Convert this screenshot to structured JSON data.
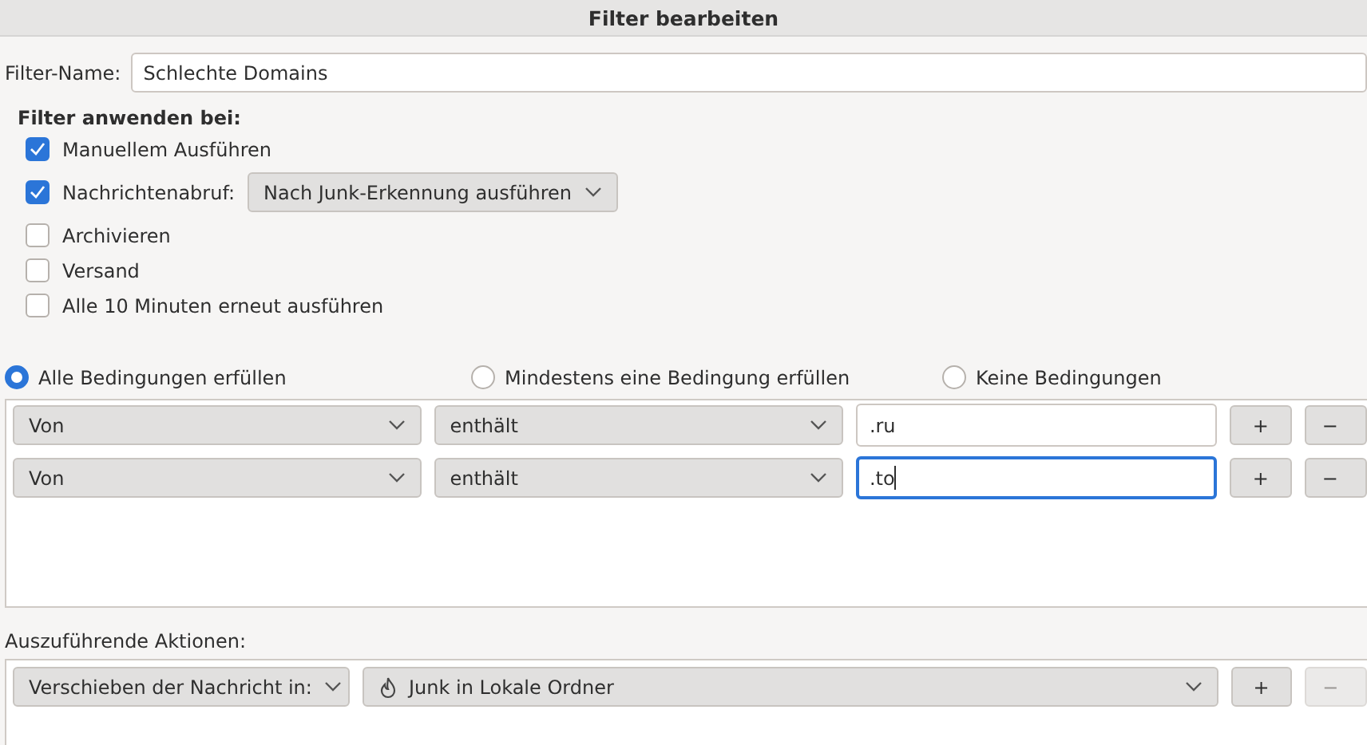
{
  "window": {
    "title": "Filter bearbeiten"
  },
  "filter_name": {
    "label": "Filter-Name:",
    "value": "Schlechte Domains"
  },
  "apply_section": {
    "heading": "Filter anwenden bei:",
    "options": [
      {
        "label": "Manuellem Ausführen",
        "checked": true
      },
      {
        "label": "Nachrichtenabruf:",
        "checked": true,
        "dropdown": "Nach Junk-Erkennung ausführen"
      },
      {
        "label": "Archivieren",
        "checked": false
      },
      {
        "label": "Versand",
        "checked": false
      },
      {
        "label": "Alle 10 Minuten erneut ausführen",
        "checked": false
      }
    ]
  },
  "match_mode": [
    {
      "label": "Alle Bedingungen erfüllen",
      "selected": true
    },
    {
      "label": "Mindestens eine Bedingung erfüllen",
      "selected": false
    },
    {
      "label": "Keine Bedingungen",
      "selected": false
    }
  ],
  "conditions": [
    {
      "field": "Von",
      "operator": "enthält",
      "value": ".ru",
      "focused": false,
      "add": "+",
      "remove": "−"
    },
    {
      "field": "Von",
      "operator": "enthält",
      "value": ".to",
      "focused": true,
      "add": "+",
      "remove": "−"
    }
  ],
  "actions": {
    "heading": "Auszuführende Aktionen:",
    "rows": [
      {
        "action": "Verschieben der Nachricht in:",
        "target": "Junk in Lokale Ordner",
        "add": "+",
        "remove": "−",
        "remove_disabled": true
      }
    ]
  }
}
